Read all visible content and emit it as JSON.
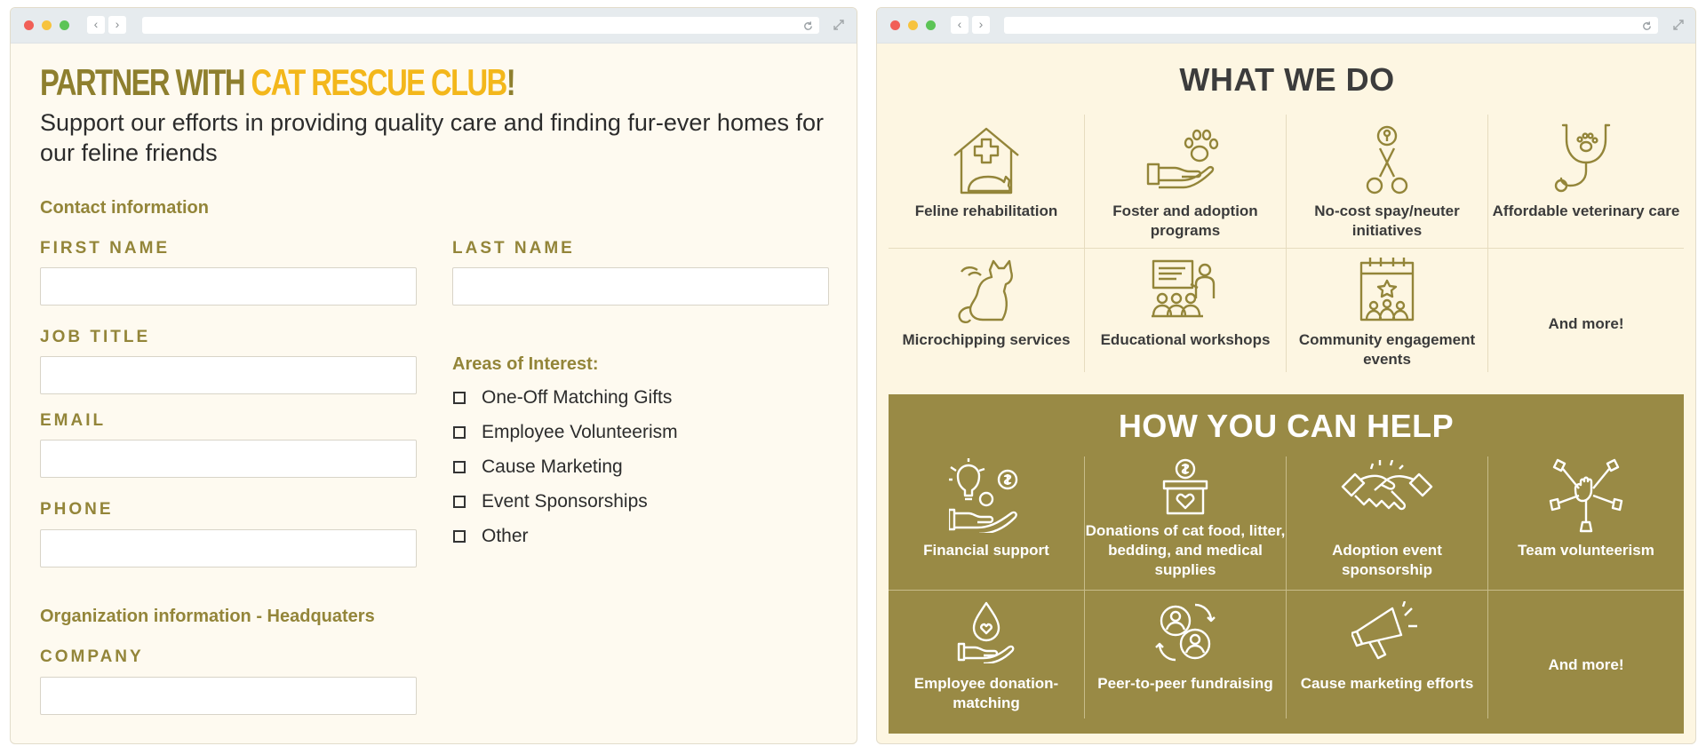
{
  "left_form": {
    "title_part1": "PARTNER WITH ",
    "title_part2": "CAT RESCUE CLUB",
    "title_part3": "!",
    "subtitle": "Support our efforts in providing quality care and finding fur-ever homes for our feline friends",
    "contact_heading": "Contact information",
    "fields": {
      "first_name": "FIRST NAME",
      "last_name": "LAST NAME",
      "job_title": "JOB TITLE",
      "email": "EMAIL",
      "phone": "PHONE",
      "company": "COMPANY"
    },
    "interests_heading": "Areas of Interest:",
    "interests": [
      "One-Off Matching Gifts",
      "Employee Volunteerism",
      "Cause Marketing",
      "Event Sponsorships",
      "Other"
    ],
    "org_heading": "Organization information - Headquaters"
  },
  "what_we_do": {
    "title": "WHAT WE DO",
    "items": [
      {
        "label": "Feline rehabilitation",
        "icon": "cat-house-icon"
      },
      {
        "label": "Foster and adoption programs",
        "icon": "paw-hand-icon"
      },
      {
        "label": "No-cost spay/neuter initiatives",
        "icon": "scissors-icon"
      },
      {
        "label": "Affordable veterinary care",
        "icon": "stethoscope-icon"
      },
      {
        "label": "Microchipping services",
        "icon": "cat-icon"
      },
      {
        "label": "Educational workshops",
        "icon": "presentation-icon"
      },
      {
        "label": "Community engagement events",
        "icon": "calendar-people-icon"
      },
      {
        "label": "And more!",
        "icon": ""
      }
    ]
  },
  "how_you_can_help": {
    "title": "HOW YOU CAN HELP",
    "items": [
      {
        "label": "Financial support",
        "icon": "idea-money-hand-icon"
      },
      {
        "label": "Donations of cat food, litter, bedding, and medical supplies",
        "icon": "donation-box-icon"
      },
      {
        "label": "Adoption event sponsorship",
        "icon": "handshake-icon"
      },
      {
        "label": "Team volunteerism",
        "icon": "team-hands-icon"
      },
      {
        "label": "Employee donation-matching",
        "icon": "donation-drop-icon"
      },
      {
        "label": "Peer-to-peer fundraising",
        "icon": "peer-exchange-icon"
      },
      {
        "label": "Cause marketing efforts",
        "icon": "megaphone-icon"
      },
      {
        "label": "And more!",
        "icon": ""
      }
    ]
  },
  "colors": {
    "olive": "#938539",
    "gold": "#f3b71b",
    "help_bg": "#998a45",
    "cream": "#fefaf0"
  }
}
